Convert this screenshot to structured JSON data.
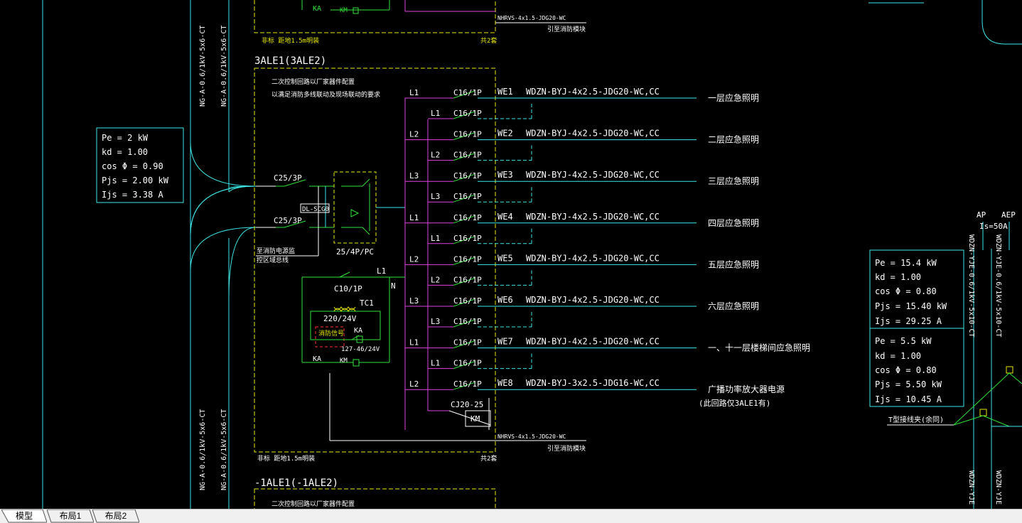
{
  "colors": {
    "cyan": "#3ce8e8",
    "green": "#2fe23a",
    "yellow": "#e6e600",
    "white": "#ffffff",
    "magenta": "#e040e0",
    "red": "#ff3030"
  },
  "top_panel": {
    "note_left": "非标 距地1.5m明装",
    "note_right": "共2套",
    "cable": "NHRVS-4x1.5-JDG20-WC",
    "cable_note": "引至消防模块",
    "ka": "KA",
    "km": "KM"
  },
  "left_cables": {
    "top": [
      "NG-A-0.6/1kV-5x6-CT",
      "NG-A-0.6/1kV-5x6-CT"
    ],
    "bottom": [
      "NG-A-0.6/1kV-5x6-CT",
      "NG-A-0.6/1kV-5x6-CT"
    ]
  },
  "load_box_left": [
    "Pe = 2 kW",
    "kd = 1.00",
    "cos Φ = 0.90",
    "Pjs = 2.00 kW",
    "Ijs = 3.38 A"
  ],
  "panel": {
    "title": "3ALE1(3ALE2)",
    "note1": "二次控制回路以厂家器件配置",
    "note2": "以满足消防多线联动及现场联动的要求",
    "breaker1": "C25/3P",
    "breaker2": "C25/3P",
    "dual_label": "DL-SCG0",
    "ats_label": "25/4P/PC",
    "left_note1": "至消防电源监",
    "left_note2": "控区域总线",
    "ctrl_breaker": "C10/1P",
    "ctrl_l1": "L1",
    "ctrl_n": "N",
    "transformer": "TC1",
    "volt": "220/24V",
    "alarm": "消防信号",
    "ka": "KA",
    "ka_range": "127-46/24V",
    "km_ka": "KA",
    "km": "KM",
    "contactor": "CJ20-25",
    "contactor_km": "KM",
    "note_bottom_left": "非标 距地1.5m明装",
    "note_bottom_right": "共2套",
    "cable_bottom": "NHRVS-4x1.5-JDG20-WC",
    "cable_bottom_note": "引至消防模块"
  },
  "circuits": [
    {
      "phase": "L1",
      "breaker": "C16/1P",
      "id": "WE1",
      "cable": "WDZN-BYJ-4x2.5-JDG20-WC,CC",
      "dest": "一层应急照明",
      "phase2": "L1",
      "breaker2": "C16/1P"
    },
    {
      "phase": "L2",
      "breaker": "C16/1P",
      "id": "WE2",
      "cable": "WDZN-BYJ-4x2.5-JDG20-WC,CC",
      "dest": "二层应急照明",
      "phase2": "L2",
      "breaker2": "C16/1P"
    },
    {
      "phase": "L3",
      "breaker": "C16/1P",
      "id": "WE3",
      "cable": "WDZN-BYJ-4x2.5-JDG20-WC,CC",
      "dest": "三层应急照明",
      "phase2": "L3",
      "breaker2": "C16/1P"
    },
    {
      "phase": "L1",
      "breaker": "C16/1P",
      "id": "WE4",
      "cable": "WDZN-BYJ-4x2.5-JDG20-WC,CC",
      "dest": "四层应急照明",
      "phase2": "L1",
      "breaker2": "C16/1P"
    },
    {
      "phase": "L2",
      "breaker": "C16/1P",
      "id": "WE5",
      "cable": "WDZN-BYJ-4x2.5-JDG20-WC,CC",
      "dest": "五层应急照明",
      "phase2": "L2",
      "breaker2": "C16/1P"
    },
    {
      "phase": "L3",
      "breaker": "C16/1P",
      "id": "WE6",
      "cable": "WDZN-BYJ-4x2.5-JDG20-WC,CC",
      "dest": "六层应急照明",
      "phase2": "L3",
      "breaker2": "C16/1P"
    },
    {
      "phase": "L1",
      "breaker": "C16/1P",
      "id": "WE7",
      "cable": "WDZN-BYJ-4x2.5-JDG20-WC,CC",
      "dest": "一、十一层楼梯间应急照明",
      "phase2": "L1",
      "breaker2": "C16/1P"
    },
    {
      "phase": "L2",
      "breaker": "C16/1P",
      "id": "WE8",
      "cable": "WDZN-BYJ-3x2.5-JDG16-WC,CC",
      "dest": "广播功率放大器电源",
      "phase2": "",
      "breaker2": ""
    }
  ],
  "circuit8_dest2": "(此回路仅3ALE1有)",
  "bottom_panel": {
    "title": "-1ALE1(-1ALE2)",
    "note": "二次控制回路以厂家器件配置"
  },
  "right_side": {
    "ap": "AP",
    "aep": "AEP",
    "is": "Is=50A",
    "cable1": "WDZN-YJE-0.6/1kV-5x10-CT",
    "cable2": "WDZN-YJE-0.6/1kV-5x10-CT",
    "cable3": "WDZN-YJE",
    "cable4": "WDZN-YJE",
    "load1": [
      "Pe = 15.4 kW",
      "kd = 1.00",
      "cos Φ = 0.80",
      "Pjs = 15.40 kW",
      "Ijs = 29.25 A"
    ],
    "load2": [
      "Pe = 5.5 kW",
      "kd = 1.00",
      "cos Φ = 0.80",
      "Pjs = 5.50 kW",
      "Ijs = 10.45 A"
    ],
    "tjoint": "T型接线夹(余同)"
  },
  "tabs": [
    "模型",
    "布局1",
    "布局2"
  ]
}
